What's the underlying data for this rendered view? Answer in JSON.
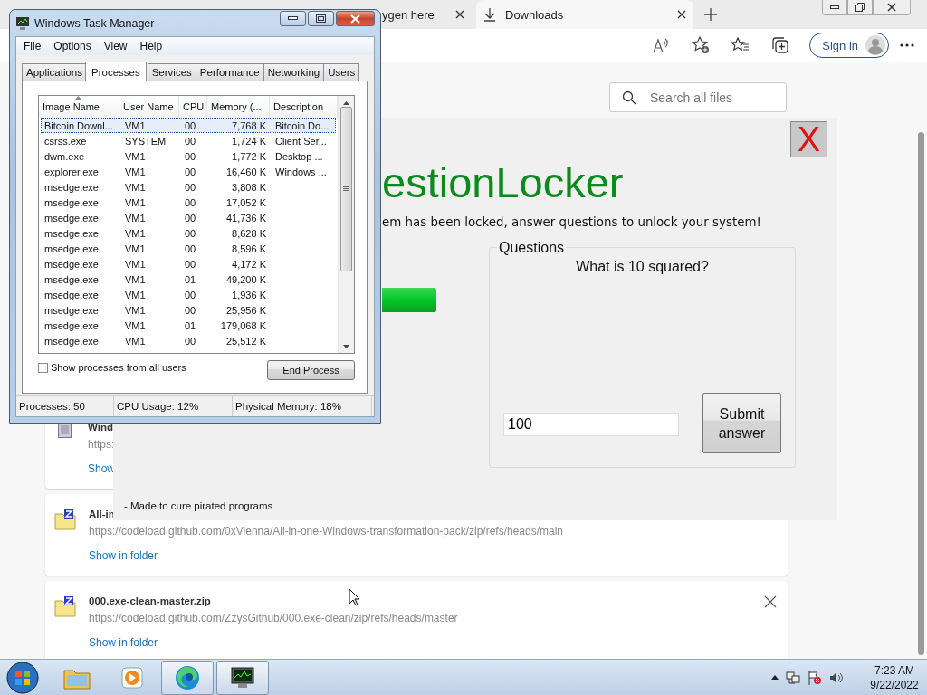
{
  "browser": {
    "tabs": [
      {
        "title": "ygen here",
        "selected": false
      },
      {
        "title": "Downloads",
        "selected": true
      }
    ],
    "sign_in": "Sign in",
    "search": {
      "placeholder": "Search all files"
    },
    "downloads": [
      {
        "kind": "installer",
        "title": "Wind",
        "url": "https:",
        "action": "Show",
        "closable": false
      },
      {
        "kind": "zip",
        "title": "All-in",
        "url": "https://codeload.github.com/0xVienna/All-in-one-Windows-transformation-pack/zip/refs/heads/main",
        "action": "Show in folder",
        "closable": false
      },
      {
        "kind": "zip",
        "title": "000.exe-clean-master.zip",
        "url": "https://codeload.github.com/ZzysGithub/000.exe-clean/zip/refs/heads/master",
        "action": "Show in folder",
        "closable": true
      }
    ]
  },
  "locker": {
    "title": "estionLocker",
    "subtitle": "em has been locked, answer questions to unlock your system!",
    "close": "X",
    "group": "Questions",
    "question": "What is 10 squared?",
    "answer": "100",
    "submit": "Submit answer",
    "footer": "- Made to cure pirated programs"
  },
  "task_manager": {
    "title": "Windows Task Manager",
    "menu": [
      "File",
      "Options",
      "View",
      "Help"
    ],
    "tabs": [
      {
        "label": "Applications",
        "selected": false
      },
      {
        "label": "Processes",
        "selected": true
      },
      {
        "label": "Services",
        "selected": false
      },
      {
        "label": "Performance",
        "selected": false
      },
      {
        "label": "Networking",
        "selected": false
      },
      {
        "label": "Users",
        "selected": false
      }
    ],
    "columns": [
      "Image Name",
      "User Name",
      "CPU",
      "Memory (...",
      "Description"
    ],
    "rows": [
      {
        "name": "Bitcoin Downl...",
        "user": "VM1",
        "cpu": "00",
        "memory": "7,768 K",
        "description": "Bitcoin Do...",
        "selected": true
      },
      {
        "name": "csrss.exe",
        "user": "SYSTEM",
        "cpu": "00",
        "memory": "1,724 K",
        "description": "Client Ser...",
        "selected": false
      },
      {
        "name": "dwm.exe",
        "user": "VM1",
        "cpu": "00",
        "memory": "1,772 K",
        "description": "Desktop ...",
        "selected": false
      },
      {
        "name": "explorer.exe",
        "user": "VM1",
        "cpu": "00",
        "memory": "16,460 K",
        "description": "Windows ...",
        "selected": false
      },
      {
        "name": "msedge.exe",
        "user": "VM1",
        "cpu": "00",
        "memory": "3,808 K",
        "selected": false
      },
      {
        "name": "msedge.exe",
        "user": "VM1",
        "cpu": "00",
        "memory": "17,052 K",
        "selected": false
      },
      {
        "name": "msedge.exe",
        "user": "VM1",
        "cpu": "00",
        "memory": "41,736 K",
        "selected": false
      },
      {
        "name": "msedge.exe",
        "user": "VM1",
        "cpu": "00",
        "memory": "8,628 K",
        "selected": false
      },
      {
        "name": "msedge.exe",
        "user": "VM1",
        "cpu": "00",
        "memory": "8,596 K",
        "selected": false
      },
      {
        "name": "msedge.exe",
        "user": "VM1",
        "cpu": "00",
        "memory": "4,172 K",
        "selected": false
      },
      {
        "name": "msedge.exe",
        "user": "VM1",
        "cpu": "01",
        "memory": "49,200 K",
        "selected": false
      },
      {
        "name": "msedge.exe",
        "user": "VM1",
        "cpu": "00",
        "memory": "1,936 K",
        "selected": false
      },
      {
        "name": "msedge.exe",
        "user": "VM1",
        "cpu": "00",
        "memory": "25,956 K",
        "selected": false
      },
      {
        "name": "msedge.exe",
        "user": "VM1",
        "cpu": "01",
        "memory": "179,068 K",
        "selected": false
      },
      {
        "name": "msedge.exe",
        "user": "VM1",
        "cpu": "00",
        "memory": "25,512 K",
        "selected": false
      }
    ],
    "show_all_users": {
      "label": "Show processes from all users",
      "checked": false
    },
    "end_process": "End Process",
    "status": [
      "Processes: 50",
      "CPU Usage: 12%",
      "Physical Memory: 18%"
    ]
  },
  "taskbar": {
    "apps": [
      {
        "kind": "explorer",
        "running": false
      },
      {
        "kind": "media",
        "running": false
      },
      {
        "kind": "edge",
        "running": true
      },
      {
        "kind": "taskmgr",
        "running": true
      }
    ],
    "time": "7:23 AM",
    "date": "9/22/2022"
  }
}
